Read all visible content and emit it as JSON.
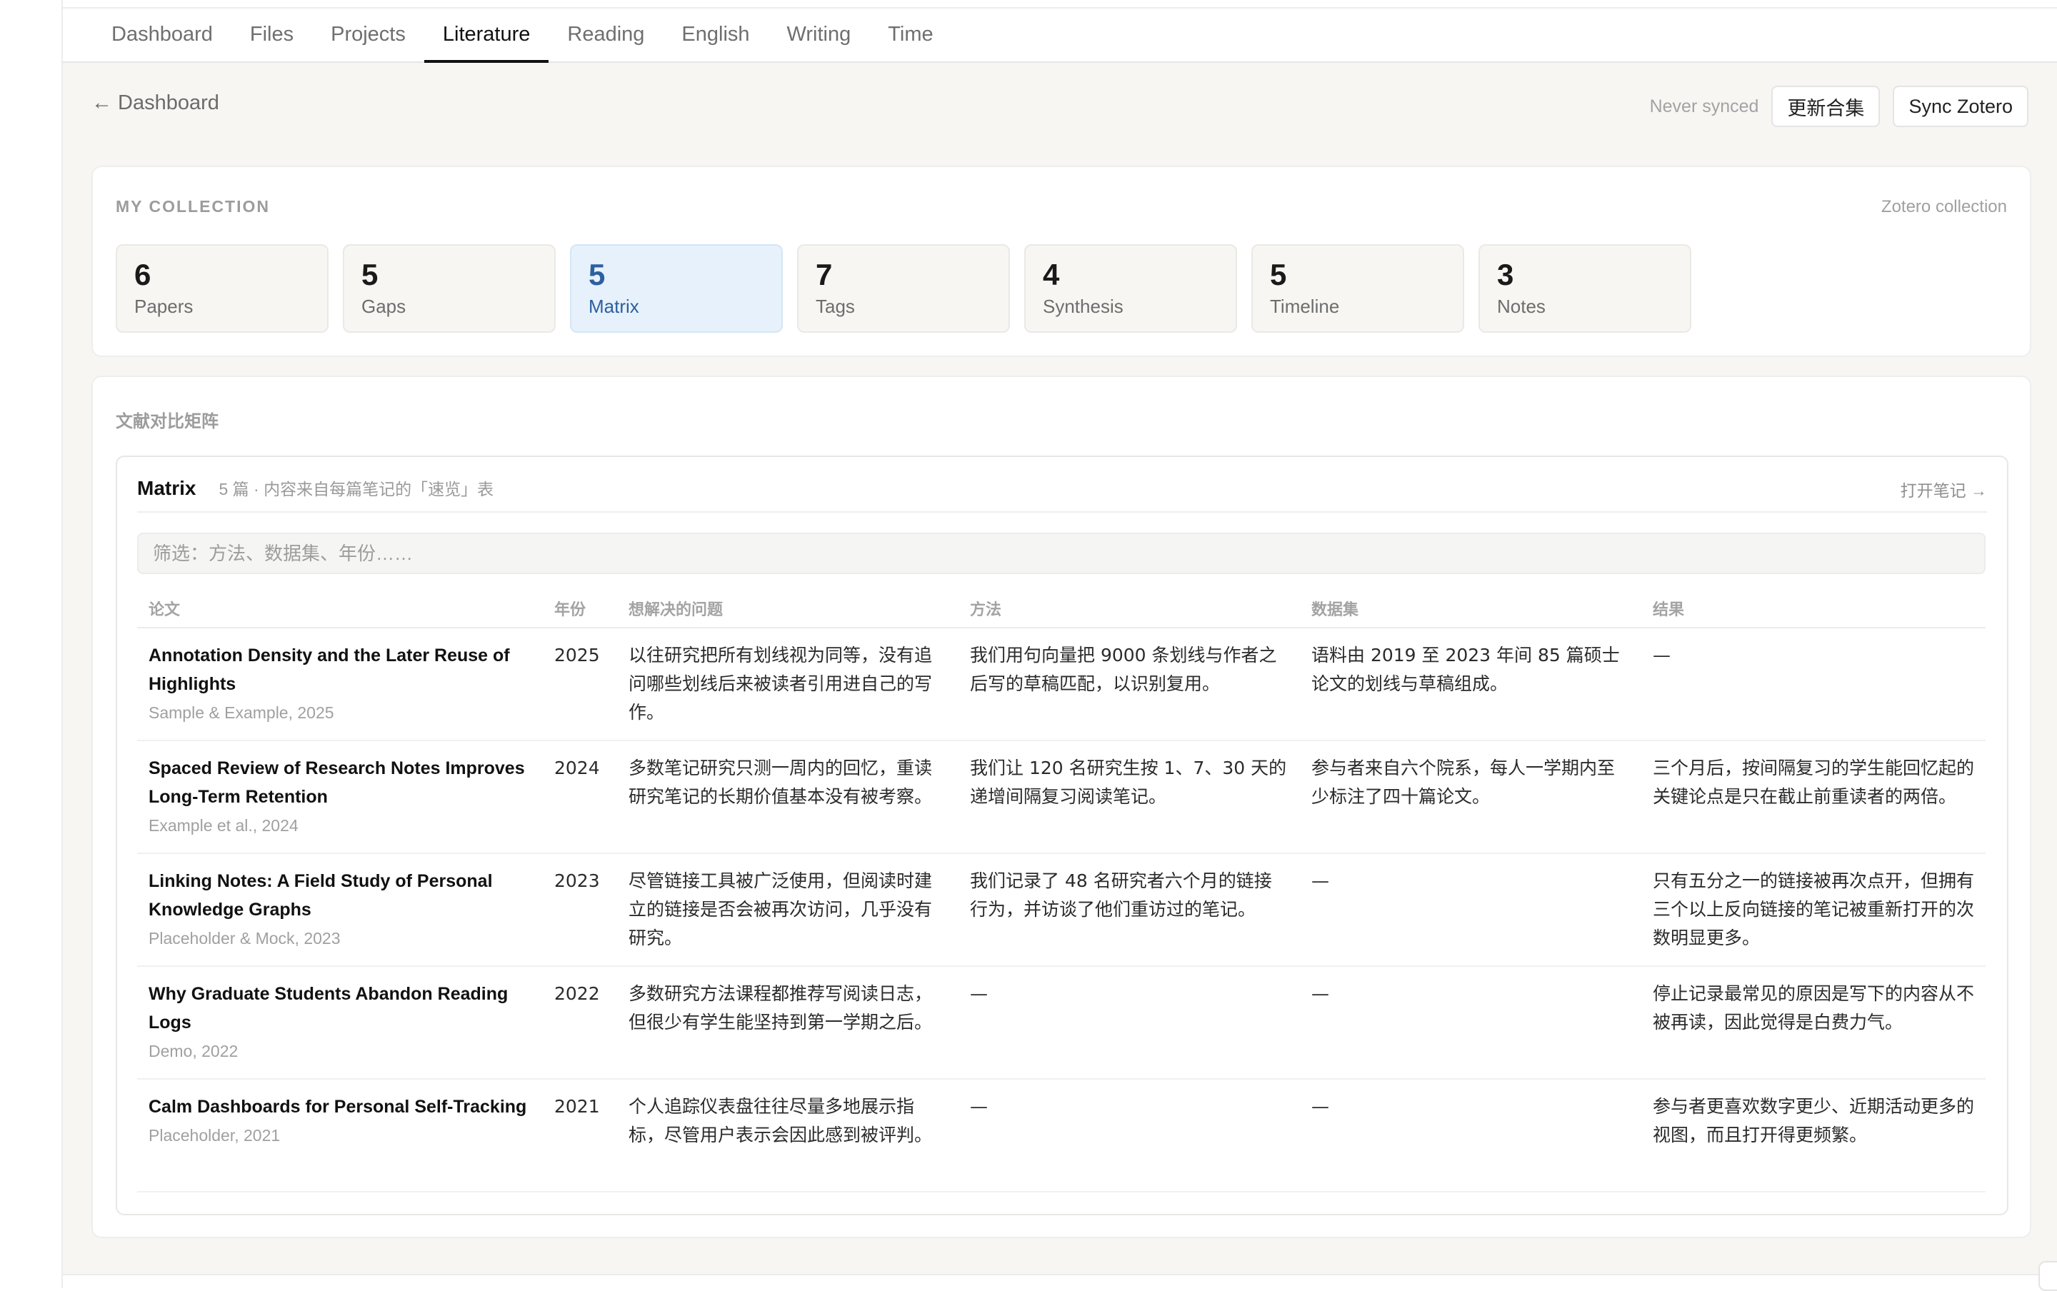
{
  "nav": {
    "tabs": [
      {
        "label": "Dashboard"
      },
      {
        "label": "Files"
      },
      {
        "label": "Projects"
      },
      {
        "label": "Literature",
        "active": true
      },
      {
        "label": "Reading"
      },
      {
        "label": "English"
      },
      {
        "label": "Writing"
      },
      {
        "label": "Time"
      }
    ]
  },
  "header": {
    "back_label": "← Dashboard",
    "sync_status": "Never synced",
    "update_button": "更新合集",
    "sync_button": "Sync Zotero"
  },
  "collection": {
    "label": "MY COLLECTION",
    "right_label": "Zotero collection",
    "stats": [
      {
        "num": "6",
        "label": "Papers"
      },
      {
        "num": "5",
        "label": "Gaps"
      },
      {
        "num": "5",
        "label": "Matrix",
        "active": true
      },
      {
        "num": "7",
        "label": "Tags"
      },
      {
        "num": "4",
        "label": "Synthesis"
      },
      {
        "num": "5",
        "label": "Timeline"
      },
      {
        "num": "3",
        "label": "Notes"
      }
    ]
  },
  "matrix": {
    "section_heading": "文献对比矩阵",
    "title": "Matrix",
    "subtitle": "5 篇 · 内容来自每篇笔记的「速览」表",
    "open_note": "打开笔记 →",
    "filter_placeholder": "筛选：方法、数据集、年份……",
    "columns": [
      "论文",
      "年份",
      "想解决的问题",
      "方法",
      "数据集",
      "结果"
    ],
    "rows": [
      {
        "title": "Annotation Density and the Later Reuse of Highlights",
        "cite": "Sample & Example, 2025",
        "year": "2025",
        "problem": "以往研究把所有划线视为同等，没有追问哪些划线后来被读者引用进自己的写作。",
        "method": "我们用句向量把 9000 条划线与作者之后写的草稿匹配，以识别复用。",
        "dataset": "语料由 2019 至 2023 年间 85 篇硕士论文的划线与草稿组成。",
        "result": "—"
      },
      {
        "title": "Spaced Review of Research Notes Improves Long-Term Retention",
        "cite": "Example et al., 2024",
        "year": "2024",
        "problem": "多数笔记研究只测一周内的回忆，重读研究笔记的长期价值基本没有被考察。",
        "method": "我们让 120 名研究生按 1、7、30 天的递增间隔复习阅读笔记。",
        "dataset": "参与者来自六个院系，每人一学期内至少标注了四十篇论文。",
        "result": "三个月后，按间隔复习的学生能回忆起的关键论点是只在截止前重读者的两倍。"
      },
      {
        "title": "Linking Notes: A Field Study of Personal Knowledge Graphs",
        "cite": "Placeholder & Mock, 2023",
        "year": "2023",
        "problem": "尽管链接工具被广泛使用，但阅读时建立的链接是否会被再次访问，几乎没有研究。",
        "method": "我们记录了 48 名研究者六个月的链接行为，并访谈了他们重访过的笔记。",
        "dataset": "—",
        "result": "只有五分之一的链接被再次点开，但拥有三个以上反向链接的笔记被重新打开的次数明显更多。"
      },
      {
        "title": "Why Graduate Students Abandon Reading Logs",
        "cite": "Demo, 2022",
        "year": "2022",
        "problem": "多数研究方法课程都推荐写阅读日志，但很少有学生能坚持到第一学期之后。",
        "method": "—",
        "dataset": "—",
        "result": "停止记录最常见的原因是写下的内容从不被再读，因此觉得是白费力气。"
      },
      {
        "title": "Calm Dashboards for Personal Self-Tracking",
        "cite": "Placeholder, 2021",
        "year": "2021",
        "problem": "个人追踪仪表盘往往尽量多地展示指标，尽管用户表示会因此感到被评判。",
        "method": "—",
        "dataset": "—",
        "result": "参与者更喜欢数字更少、近期活动更多的视图，而且打开得更频繁。"
      }
    ]
  }
}
